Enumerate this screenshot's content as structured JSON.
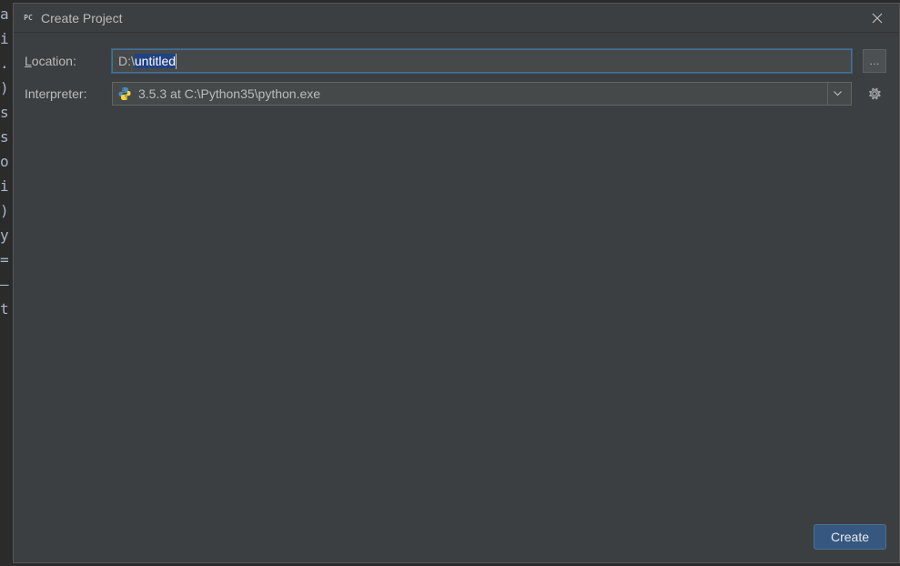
{
  "background_chars": [
    "a",
    "",
    " ",
    "i",
    ".",
    ")",
    "s",
    "s",
    "o",
    "",
    "",
    "",
    "i",
    "",
    ")",
    "",
    "",
    "y",
    "=",
    "—",
    "",
    "t"
  ],
  "dialog": {
    "title": "Create Project",
    "location": {
      "label_prefix": "L",
      "label_rest": "ocation:",
      "value_prefix": "D:\\",
      "value_selected": "untitled"
    },
    "interpreter": {
      "label": "Interpreter:",
      "selected": "3.5.3 at C:\\Python35\\python.exe"
    },
    "browse_button": "…",
    "create_button": "Create"
  }
}
